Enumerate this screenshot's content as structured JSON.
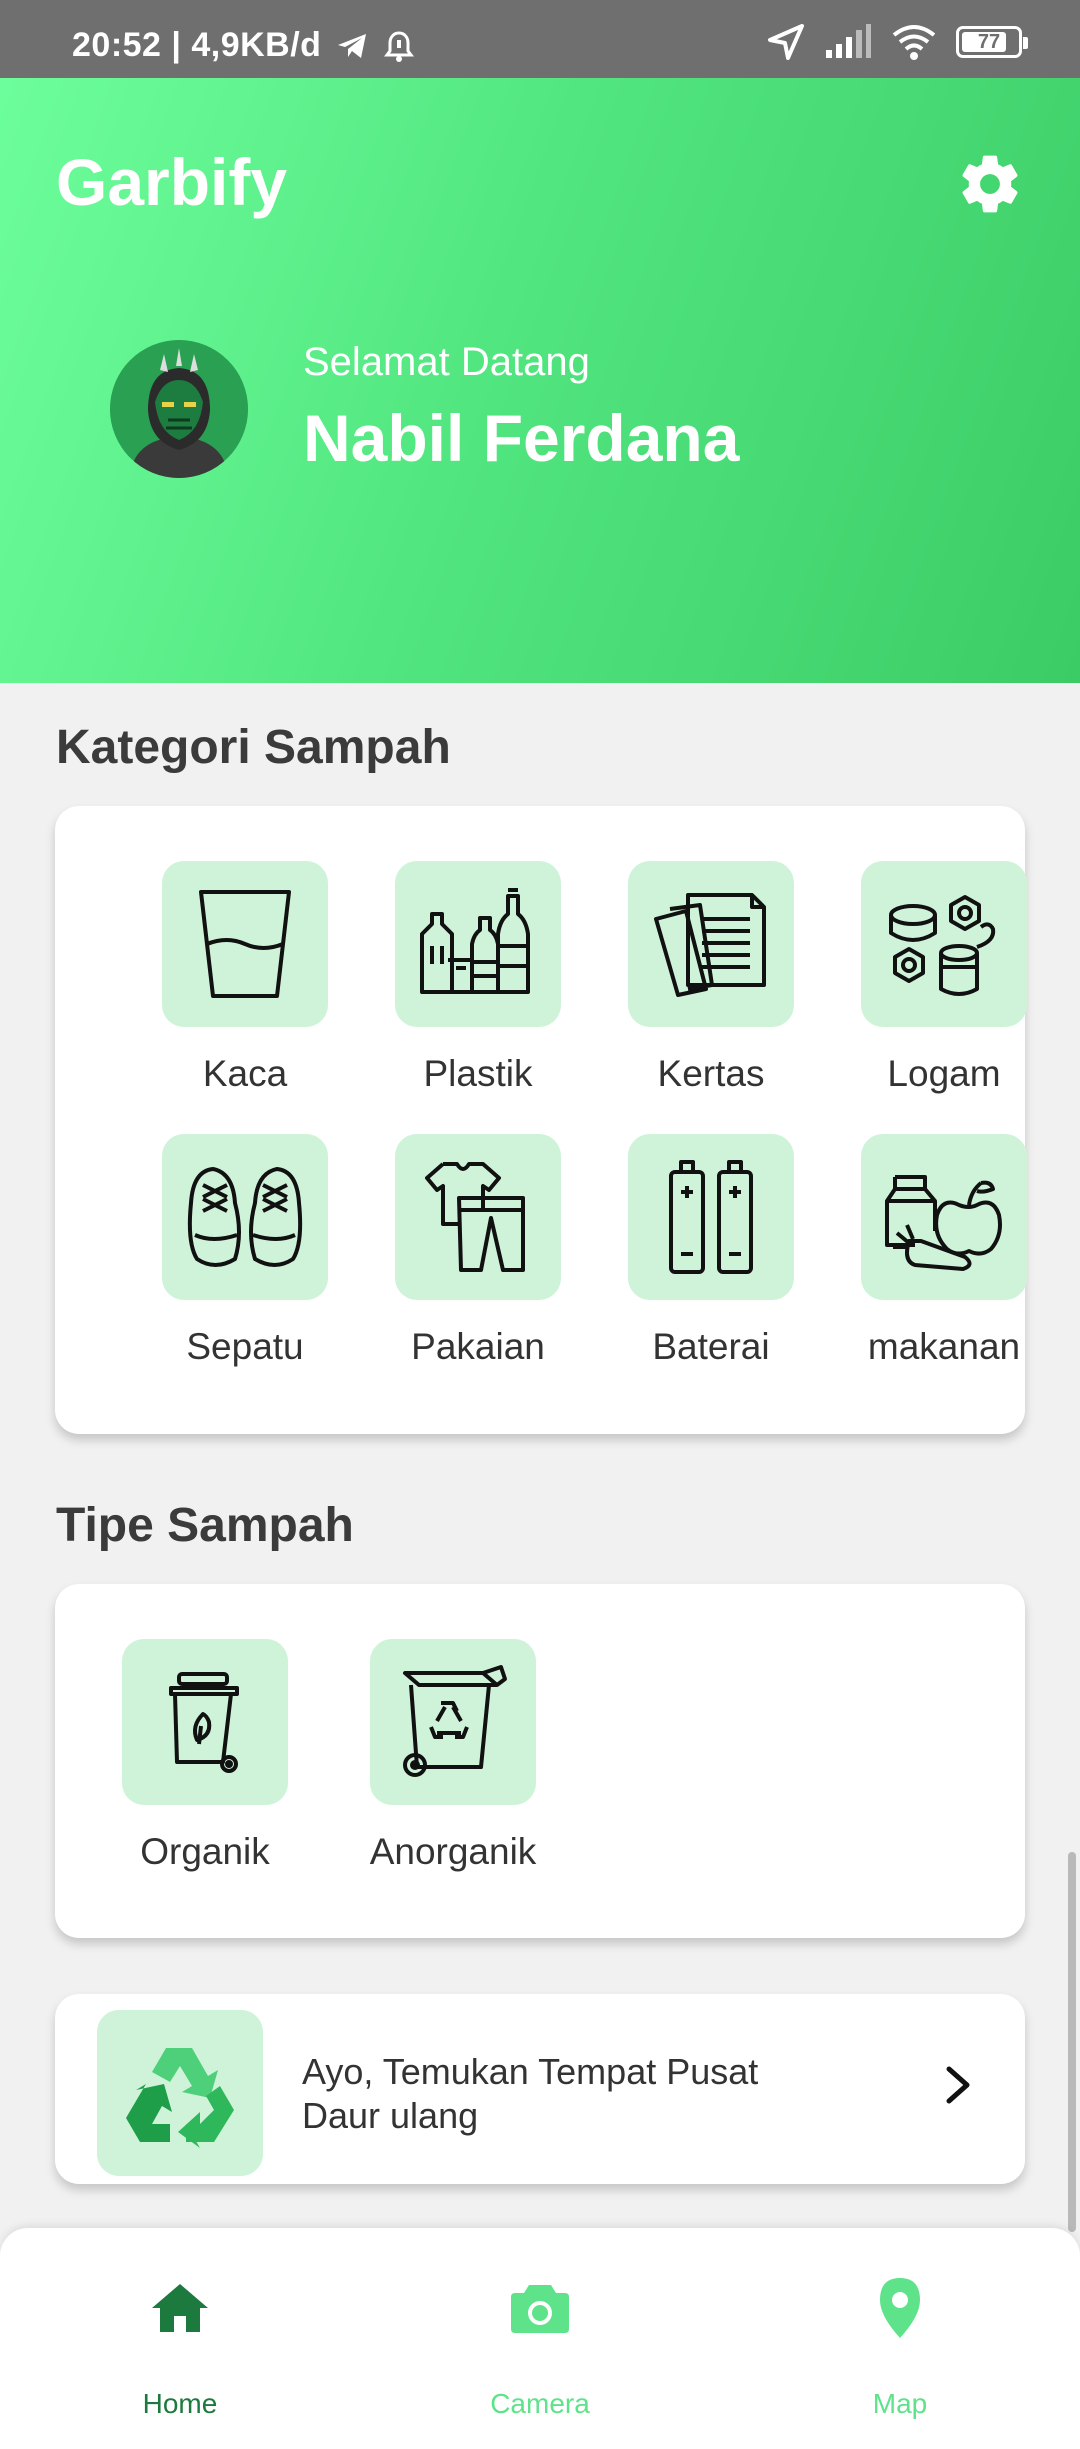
{
  "status_bar": {
    "time": "20:52 | 4,9KB/d",
    "battery": "77"
  },
  "header": {
    "app_title": "Garbify",
    "welcome_text": "Selamat Datang",
    "user_name": "Nabil Ferdana",
    "icons": {
      "settings": "gear-icon",
      "avatar": "user-avatar"
    }
  },
  "categories": {
    "title": "Kategori Sampah",
    "items": [
      {
        "label": "Kaca",
        "icon": "glass-icon"
      },
      {
        "label": "Plastik",
        "icon": "plastic-bottles-icon"
      },
      {
        "label": "Kertas",
        "icon": "paper-icon"
      },
      {
        "label": "Logam",
        "icon": "metal-icon"
      },
      {
        "label": "Sepatu",
        "icon": "shoes-icon"
      },
      {
        "label": "Pakaian",
        "icon": "clothes-icon"
      },
      {
        "label": "Baterai",
        "icon": "battery-icon"
      },
      {
        "label": "makanan",
        "icon": "food-icon"
      }
    ]
  },
  "types": {
    "title": "Tipe Sampah",
    "items": [
      {
        "label": "Organik",
        "icon": "organic-bin-icon"
      },
      {
        "label": "Anorganik",
        "icon": "recycle-bin-icon"
      }
    ]
  },
  "recycle_banner": {
    "line1": "Ayo, Temukan Tempat Pusat",
    "line2": "Daur ulang",
    "icon": "recycle-icon"
  },
  "bottom_nav": {
    "items": [
      {
        "label": "Home",
        "icon": "home-icon",
        "active": true
      },
      {
        "label": "Camera",
        "icon": "camera-icon",
        "active": false
      },
      {
        "label": "Map",
        "icon": "map-pin-icon",
        "active": false
      }
    ]
  },
  "colors": {
    "header_gradient_start": "#6dfe9c",
    "header_gradient_end": "#3ccc66",
    "icon_bg": "#cff3d9",
    "nav_active": "#1d7a3e",
    "nav_inactive": "#5ee38a"
  }
}
